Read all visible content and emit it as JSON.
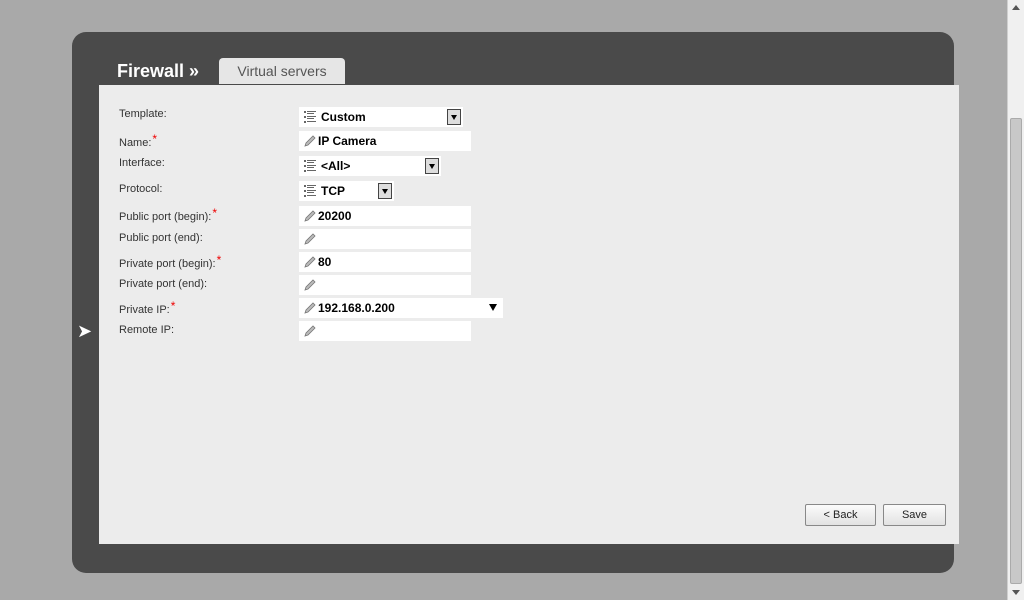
{
  "breadcrumb": {
    "section": "Firewall »",
    "tab": "Virtual servers"
  },
  "icons": {
    "list": "list-icon",
    "edit": "pencil-icon",
    "back": "chevron-left-icon"
  },
  "form": {
    "required_mark": "*",
    "fields": [
      {
        "label": "Template:",
        "required": false,
        "type": "select",
        "value": "Custom"
      },
      {
        "label": "Name:",
        "required": true,
        "type": "text",
        "value": "IP Camera"
      },
      {
        "label": "Interface:",
        "required": false,
        "type": "select",
        "value": "<All>"
      },
      {
        "label": "Protocol:",
        "required": false,
        "type": "select",
        "value": "TCP"
      },
      {
        "label": "Public port (begin):",
        "required": true,
        "type": "text",
        "value": "20200"
      },
      {
        "label": "Public port (end):",
        "required": false,
        "type": "text",
        "value": ""
      },
      {
        "label": "Private port (begin):",
        "required": true,
        "type": "text",
        "value": "80"
      },
      {
        "label": "Private port (end):",
        "required": false,
        "type": "text",
        "value": ""
      },
      {
        "label": "Private IP:",
        "required": true,
        "type": "combo",
        "value": "192.168.0.200"
      },
      {
        "label": "Remote IP:",
        "required": false,
        "type": "text",
        "value": ""
      }
    ]
  },
  "buttons": {
    "back": "< Back",
    "save": "Save"
  }
}
